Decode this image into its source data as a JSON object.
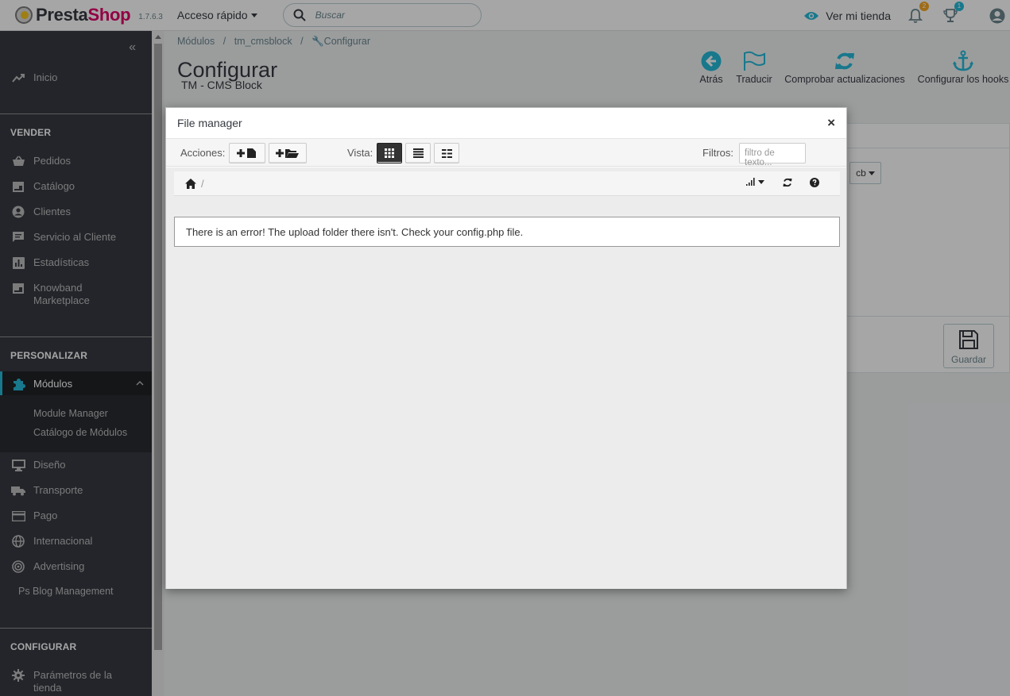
{
  "header": {
    "logo_presta": "Presta",
    "logo_shop": "Shop",
    "version": "1.7.6.3",
    "quick_access": "Acceso rápido",
    "search_placeholder": "Buscar",
    "view_shop": "Ver mi tienda",
    "notifications_count": "2",
    "trophy_count": "1"
  },
  "sidebar": {
    "home": "Inicio",
    "section_sell": "VENDER",
    "sell_items": [
      "Pedidos",
      "Catálogo",
      "Clientes",
      "Servicio al Cliente",
      "Estadísticas",
      "Knowband Marketplace"
    ],
    "section_customize": "PERSONALIZAR",
    "modules": "Módulos",
    "modules_sub": [
      "Module Manager",
      "Catálogo de Módulos"
    ],
    "customize_items": [
      "Diseño",
      "Transporte",
      "Pago",
      "Internacional",
      "Advertising"
    ],
    "blog": "Ps Blog Management",
    "section_configure": "CONFIGURAR",
    "shop_params": "Parámetros de la tienda"
  },
  "main": {
    "breadcrumb": [
      "Módulos",
      "tm_cmsblock",
      "Configurar"
    ],
    "title": "Configurar",
    "subtitle": "TM - CMS Block",
    "toolbar": [
      "Atrás",
      "Traducir",
      "Comprobar actualizaciones",
      "Configurar los hooks"
    ],
    "cb_label": "cb",
    "save_label": "Guardar"
  },
  "modal": {
    "title": "File manager",
    "close": "×",
    "actions_label": "Acciones:",
    "view_label": "Vista:",
    "filters_label": "Filtros:",
    "filter_placeholder": "filtro de texto...",
    "breadcrumb_sep": "/",
    "error": "There is an error! The upload folder there isn't. Check your config.php file."
  },
  "colors": {
    "sidebar_bg": "#363a41",
    "accent": "#25b9d7",
    "brand_pink": "#df0067",
    "badge_orange": "#f5a623"
  }
}
